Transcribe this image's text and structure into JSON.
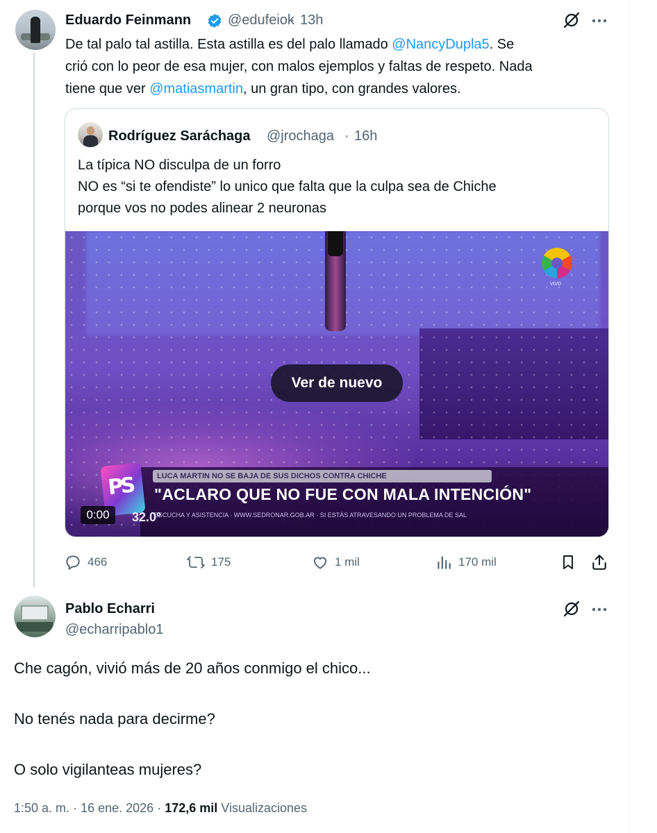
{
  "tweet1": {
    "author_name": "Eduardo Feinmann",
    "handle": "@edufeiok",
    "dot": "·",
    "time": "13h",
    "text": {
      "p1": "De tal palo tal astilla. Esta astilla  es del palo llamado ",
      "mention1": "@NancyDupla5",
      "p2": ".  Se",
      "line2": "crió con lo peor de esa mujer, con malos ejemplos y faltas de respeto. Nada",
      "p3": "tiene que ver ",
      "mention2": "@matiasmartin",
      "p4": ", un gran tipo, con grandes valores."
    },
    "quote": {
      "author_name": "Rodríguez Saráchaga",
      "handle": "@jrochaga",
      "dot": "·",
      "time": "16h",
      "line1": "La típica NO disculpa de un forro",
      "line2": "NO es “si te ofendiste” lo unico que falta que la culpa sea de Chiche",
      "line3": "porque vos no podes alinear 2 neuronas",
      "video": {
        "replay_label": "Ver de nuevo",
        "timer": "0:00",
        "channel_tag": "vivo",
        "lower_third_sub": "LUCA MARTIN NO SE BAJA DE SUS DICHOS CONTRA CHICHE",
        "lower_third_main": "\"ACLARO QUE NO FUE CON MALA INTENCIÓN\"",
        "ticker": "ESCUCHA Y ASISTENCIA · WWW.SEDRONAR.GOB.AR  ·  SI ESTÁS ATRAVESANDO UN PROBLEMA DE SAL",
        "temperature": "32.0°"
      }
    },
    "actions": {
      "replies": "466",
      "reposts": "175",
      "likes": "1 mil",
      "views": "170 mil"
    }
  },
  "tweet2": {
    "author_name": "Pablo Echarri",
    "handle": "@echarripablo1",
    "line1": "Che cagón, vivió más de 20 años conmigo  el chico...",
    "line2": "No tenés nada para decirme?",
    "line3": "O solo vigilanteas mujeres?",
    "footer": {
      "time": "1:50 a. m.",
      "dot1": "·",
      "date": "16 ene. 2026",
      "dot2": "·",
      "views_count": "172,6 mil",
      "views_label": "Visualizaciones"
    }
  },
  "colors": {
    "accent": "#1d9bf0",
    "text": "#0f1419",
    "muted": "#536471",
    "border": "#cfd9de"
  }
}
